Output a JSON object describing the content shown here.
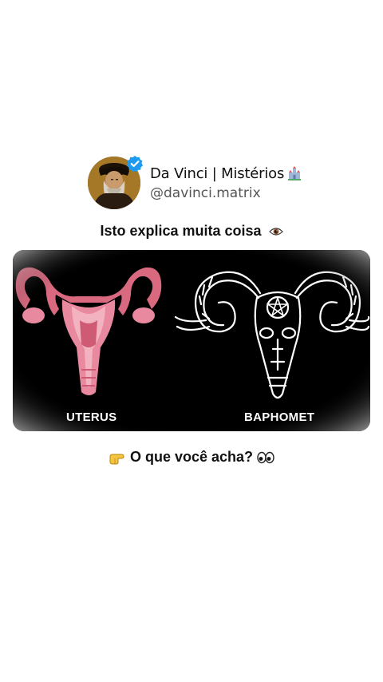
{
  "post": {
    "author": {
      "display_name": "Da Vinci | Mistérios",
      "handle": "@davinci.matrix",
      "verified": true,
      "avatar_icon": "bearded-man-portrait",
      "name_emoji_icon": "castle-icon"
    },
    "headline": {
      "text": "Isto explica muita coisa",
      "trailing_icon": "eye-icon"
    },
    "image": {
      "left_label": "UTERUS",
      "right_label": "BAPHOMET",
      "left_icon": "uterus-illustration",
      "right_icon": "ram-skull-illustration"
    },
    "question": {
      "leading_icon": "pointing-hand-icon",
      "text": "O que você acha?",
      "trailing_icon": "eyes-icon"
    }
  },
  "colors": {
    "background": "#ffffff",
    "verified_badge": "#1d9bf0",
    "uterus_pink": "#e07a93",
    "image_background": "#000000"
  }
}
